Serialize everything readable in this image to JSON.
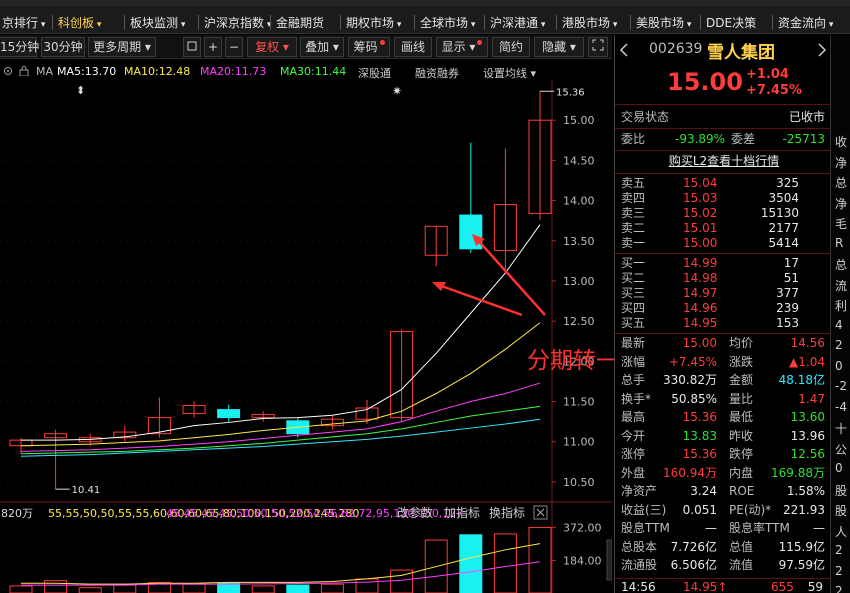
{
  "top_menu": {
    "items": [
      {
        "label": "京排行",
        "caret": true,
        "selected": false
      },
      {
        "label": "科创板",
        "caret": true,
        "selected": true
      },
      {
        "label": "板块监测",
        "caret": true,
        "selected": false
      },
      {
        "label": "沪深京指数",
        "caret": true,
        "selected": false
      },
      {
        "label": "金融期货",
        "caret": false,
        "selected": false
      },
      {
        "label": "期权市场",
        "caret": true,
        "selected": false
      },
      {
        "label": "全球市场",
        "caret": true,
        "selected": false
      },
      {
        "label": "沪深港通",
        "caret": true,
        "selected": false
      },
      {
        "label": "港股市场",
        "caret": true,
        "selected": false
      },
      {
        "label": "美股市场",
        "caret": true,
        "selected": false
      },
      {
        "label": "DDE决策",
        "caret": false,
        "selected": false
      },
      {
        "label": "资金流向",
        "caret": true,
        "selected": false
      }
    ]
  },
  "toolbar": {
    "period_15": "15分钟",
    "period_30": "30分钟",
    "more_period": "更多周期",
    "restore": "复权",
    "overlay": "叠加",
    "chips": "筹码",
    "draw": "画线",
    "display": "显示",
    "simple": "简约",
    "hide": "隐藏",
    "icons": [
      "square-icon",
      "plus-icon",
      "minus-icon",
      "fullscreen-icon"
    ]
  },
  "ma_line": {
    "prefix": "MA",
    "ma5": "MA5:13.70",
    "ma10": "MA10:12.48",
    "ma20": "MA20:11.73",
    "ma30": "MA30:11.44",
    "link1": "深股通",
    "link2": "融资融券",
    "link3": "设置均线",
    "colors": {
      "ma5": "#ffffff",
      "ma10": "#ffe94a",
      "ma20": "#ff40ff",
      "ma30": "#40ff40",
      "ma60": "#33e6ff"
    }
  },
  "chart_data": {
    "type": "candlestick",
    "y_ticks": [
      "15.00",
      "14.50",
      "14.00",
      "13.50",
      "13.00",
      "12.50",
      "12.00",
      "11.50",
      "11.00",
      "10.50"
    ],
    "ylim": [
      10.3,
      15.5
    ],
    "high_label": "15.36",
    "low_label": "10.41",
    "candles": [
      {
        "o": 10.95,
        "c": 11.02,
        "h": 11.05,
        "l": 10.85
      },
      {
        "o": 11.05,
        "c": 11.1,
        "h": 11.15,
        "l": 10.41
      },
      {
        "o": 11.0,
        "c": 11.05,
        "h": 11.1,
        "l": 10.95
      },
      {
        "o": 11.05,
        "c": 11.12,
        "h": 11.2,
        "l": 11.0
      },
      {
        "o": 11.1,
        "c": 11.3,
        "h": 11.55,
        "l": 11.05
      },
      {
        "o": 11.35,
        "c": 11.45,
        "h": 11.5,
        "l": 11.3
      },
      {
        "o": 11.4,
        "c": 11.3,
        "h": 11.46,
        "l": 11.25
      },
      {
        "o": 11.3,
        "c": 11.34,
        "h": 11.38,
        "l": 11.25
      },
      {
        "o": 11.26,
        "c": 11.1,
        "h": 11.3,
        "l": 11.05
      },
      {
        "o": 11.2,
        "c": 11.28,
        "h": 11.32,
        "l": 11.15
      },
      {
        "o": 11.28,
        "c": 11.42,
        "h": 11.52,
        "l": 11.22
      },
      {
        "o": 11.3,
        "c": 12.37,
        "h": 12.4,
        "l": 11.25
      },
      {
        "o": 13.32,
        "c": 13.68,
        "h": 13.68,
        "l": 13.18
      },
      {
        "o": 13.82,
        "c": 13.4,
        "h": 14.72,
        "l": 13.35
      },
      {
        "o": 13.38,
        "c": 13.95,
        "h": 14.65,
        "l": 13.1
      },
      {
        "o": 13.84,
        "c": 15.0,
        "h": 15.36,
        "l": 13.76
      }
    ],
    "ma5": [
      11.02,
      11.02,
      11.03,
      11.06,
      11.12,
      11.2,
      11.24,
      11.29,
      11.3,
      11.33,
      11.4,
      11.65,
      12.1,
      12.6,
      13.1,
      13.7
    ],
    "ma10": [
      10.95,
      10.96,
      10.97,
      10.99,
      11.01,
      11.05,
      11.09,
      11.14,
      11.18,
      11.22,
      11.26,
      11.38,
      11.6,
      11.85,
      12.15,
      12.48
    ],
    "ma20": [
      10.88,
      10.89,
      10.9,
      10.92,
      10.94,
      10.97,
      11.0,
      11.04,
      11.08,
      11.12,
      11.16,
      11.25,
      11.38,
      11.5,
      11.6,
      11.73
    ],
    "ma30": [
      10.85,
      10.86,
      10.87,
      10.88,
      10.9,
      10.92,
      10.95,
      10.98,
      11.02,
      11.06,
      11.1,
      11.16,
      11.24,
      11.32,
      11.38,
      11.44
    ],
    "ma60": [
      10.82,
      10.83,
      10.84,
      10.86,
      10.88,
      10.9,
      10.92,
      10.94,
      10.97,
      11.0,
      11.03,
      11.07,
      11.12,
      11.17,
      11.22,
      11.28
    ],
    "volume": {
      "header": "820万",
      "mavol1": [
        55,
        55,
        50,
        50,
        55,
        55,
        60,
        60,
        60,
        65,
        80,
        100,
        150,
        200,
        245,
        280
      ],
      "mavol2": [
        45,
        45,
        45,
        45,
        50,
        50,
        50,
        52,
        54,
        56,
        62,
        72,
        95,
        120,
        150,
        177
      ],
      "links": [
        "改参数",
        "加指标",
        "换指标"
      ],
      "y_ticks": [
        "372.00",
        "184.00"
      ],
      "ylim": [
        0,
        380
      ],
      "values": [
        40,
        70,
        30,
        45,
        60,
        50,
        55,
        40,
        45,
        50,
        80,
        130,
        300,
        330,
        335,
        372
      ]
    }
  },
  "stock": {
    "code": "002639",
    "name": "雪人集团",
    "price": "15.00",
    "change": "+1.04",
    "change_pct": "+7.45%",
    "trade_state_label": "交易状态",
    "trade_state": "已收市",
    "wei_bi_label": "委比",
    "wei_bi": "-93.89%",
    "wei_cha_label": "委差",
    "wei_cha": "-25713",
    "l2_link": "购买L2查看十档行情",
    "asks": [
      {
        "label": "卖五",
        "price": "15.04",
        "vol": "325"
      },
      {
        "label": "卖四",
        "price": "15.03",
        "vol": "3504"
      },
      {
        "label": "卖三",
        "price": "15.02",
        "vol": "15130"
      },
      {
        "label": "卖二",
        "price": "15.01",
        "vol": "2177"
      },
      {
        "label": "卖一",
        "price": "15.00",
        "vol": "5414"
      }
    ],
    "bids": [
      {
        "label": "买一",
        "price": "14.99",
        "vol": "17"
      },
      {
        "label": "买二",
        "price": "14.98",
        "vol": "51"
      },
      {
        "label": "买三",
        "price": "14.97",
        "vol": "377"
      },
      {
        "label": "买四",
        "price": "14.96",
        "vol": "239"
      },
      {
        "label": "买五",
        "price": "14.95",
        "vol": "153"
      }
    ],
    "stats": [
      {
        "l1": "最新",
        "v1": "15.00",
        "c1": "red",
        "l2": "均价",
        "v2": "14.56",
        "c2": "red"
      },
      {
        "l1": "涨幅",
        "v1": "+7.45%",
        "c1": "red",
        "l2": "涨跌",
        "v2": "▲1.04",
        "c2": "red"
      },
      {
        "l1": "总手",
        "v1": "330.82万",
        "c1": "white",
        "l2": "金额",
        "v2": "48.18亿",
        "c2": "cyan"
      },
      {
        "l1": "换手*",
        "v1": "50.85%",
        "c1": "white",
        "l2": "量比",
        "v2": "1.47",
        "c2": "red"
      },
      {
        "l1": "最高",
        "v1": "15.36",
        "c1": "red",
        "l2": "最低",
        "v2": "13.60",
        "c2": "green"
      },
      {
        "l1": "今开",
        "v1": "13.83",
        "c1": "green",
        "l2": "昨收",
        "v2": "13.96",
        "c2": "white"
      },
      {
        "l1": "涨停",
        "v1": "15.36",
        "c1": "red",
        "l2": "跌停",
        "v2": "12.56",
        "c2": "green"
      },
      {
        "l1": "外盘",
        "v1": "160.94万",
        "c1": "red",
        "l2": "内盘",
        "v2": "169.88万",
        "c2": "green"
      },
      {
        "l1": "净资产",
        "v1": "3.24",
        "c1": "white",
        "l2": "ROE",
        "v2": "1.58%",
        "c2": "white"
      },
      {
        "l1": "收益(三)",
        "v1": "0.051",
        "c1": "white",
        "l2": "PE(动)*",
        "v2": "221.93",
        "c2": "white"
      },
      {
        "l1": "股息TTM",
        "v1": "—",
        "c1": "white",
        "l2": "股息率TTM",
        "v2": "—",
        "c2": "white"
      },
      {
        "l1": "总股本",
        "v1": "7.726亿",
        "c1": "white",
        "l2": "总值",
        "v2": "115.9亿",
        "c2": "white"
      },
      {
        "l1": "流通股",
        "v1": "6.506亿",
        "c1": "white",
        "l2": "流值",
        "v2": "97.59亿",
        "c2": "white"
      }
    ],
    "tick": {
      "time": "14:56",
      "price": "14.95",
      "vol": "655",
      "count": "59"
    }
  },
  "right_strip": [
    "收",
    "净",
    "总",
    "净",
    "毛",
    "R",
    "总",
    "流",
    "利",
    "4",
    "2",
    "0",
    "-2",
    "-4",
    "十",
    "公",
    "0",
    "股",
    "股",
    "人",
    "2",
    "2",
    "2",
    "2"
  ],
  "annotation": "分期转一致",
  "colors": {
    "up": "#ff3b3b",
    "down": "#19f0f0",
    "grid": "#5a1010",
    "axis": "#7a1a1a"
  }
}
